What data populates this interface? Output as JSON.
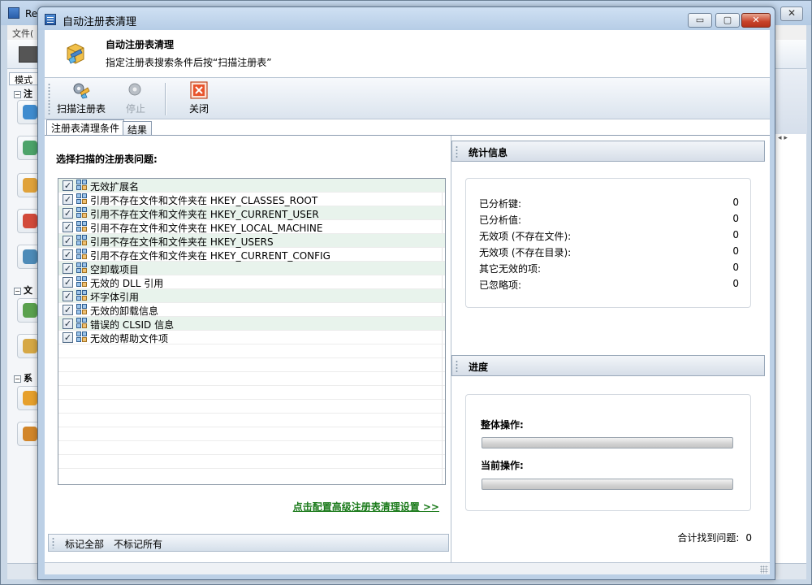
{
  "background_window": {
    "title": "Re",
    "menu": "文件(",
    "mode_tab": "模式",
    "groups": [
      "注",
      "文",
      "系"
    ],
    "close_glyph": "✕"
  },
  "dialog": {
    "title": "自动注册表清理",
    "caption": {
      "minimize": "▭",
      "maximize": "▢",
      "close": "✕"
    }
  },
  "header": {
    "title": "自动注册表清理",
    "subtitle": "指定注册表搜索条件后按“扫描注册表”"
  },
  "toolbar": {
    "scan_label": "扫描注册表",
    "stop_label": "停止",
    "close_label": "关闭"
  },
  "tabs": {
    "conditions": "注册表清理条件",
    "results": "结果"
  },
  "left": {
    "issues_label": "选择扫描的注册表问题:",
    "issues": [
      {
        "label": "无效扩展名",
        "checked": true
      },
      {
        "label": "引用不存在文件和文件夹在 HKEY_CLASSES_ROOT",
        "checked": true
      },
      {
        "label": "引用不存在文件和文件夹在 HKEY_CURRENT_USER",
        "checked": true
      },
      {
        "label": "引用不存在文件和文件夹在 HKEY_LOCAL_MACHINE",
        "checked": true
      },
      {
        "label": "引用不存在文件和文件夹在 HKEY_USERS",
        "checked": true
      },
      {
        "label": "引用不存在文件和文件夹在 HKEY_CURRENT_CONFIG",
        "checked": true
      },
      {
        "label": "空卸载项目",
        "checked": true
      },
      {
        "label": "无效的 DLL 引用",
        "checked": true
      },
      {
        "label": "坏字体引用",
        "checked": true
      },
      {
        "label": "无效的卸载信息",
        "checked": true
      },
      {
        "label": "错误的 CLSID 信息",
        "checked": true
      },
      {
        "label": "无效的帮助文件项",
        "checked": true
      }
    ],
    "check_glyph": "✓",
    "advanced_link": "点击配置高级注册表清理设置 >>",
    "mark_all": "标记全部",
    "unmark_all": "不标记所有"
  },
  "right": {
    "stats_title": "统计信息",
    "stats": [
      {
        "label": "已分析键:",
        "value": "0"
      },
      {
        "label": "已分析值:",
        "value": "0"
      },
      {
        "label": "无效项 (不存在文件):",
        "value": "0"
      },
      {
        "label": "无效项 (不存在目录):",
        "value": "0"
      },
      {
        "label": "其它无效的项:",
        "value": "0"
      },
      {
        "label": "已忽略项:",
        "value": "0"
      }
    ],
    "progress_title": "进度",
    "overall_label": "整体操作:",
    "overall_progress": 0,
    "current_label": "当前操作:",
    "current_progress": 0,
    "total_label": "合计找到问题:",
    "total_value": "0"
  },
  "colors": {
    "link": "#1a7a1a",
    "alt_row": "#e8f3ec",
    "close_button": "#c8432a"
  }
}
